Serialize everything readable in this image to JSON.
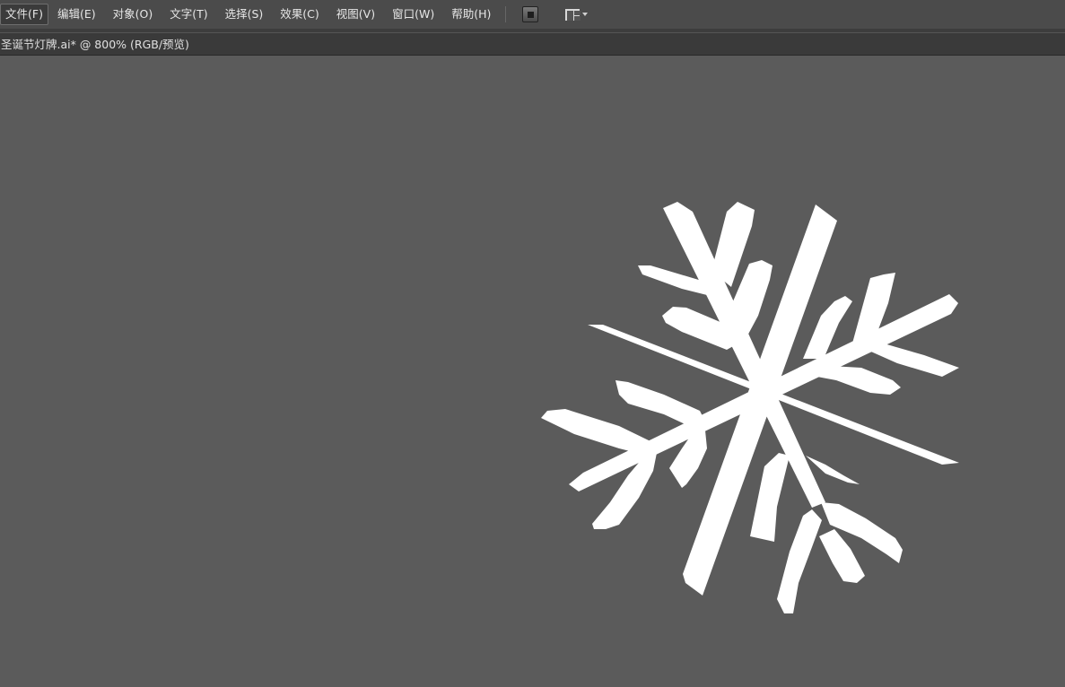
{
  "menubar": {
    "items": [
      {
        "label": "文件(F)"
      },
      {
        "label": "编辑(E)"
      },
      {
        "label": "对象(O)"
      },
      {
        "label": "文字(T)"
      },
      {
        "label": "选择(S)"
      },
      {
        "label": "效果(C)"
      },
      {
        "label": "视图(V)"
      },
      {
        "label": "窗口(W)"
      },
      {
        "label": "帮助(H)"
      }
    ],
    "bridge_icon": "bridge-icon",
    "arrange_icon": "arrange-documents-icon"
  },
  "document": {
    "tab_title": "圣诞节灯牌.ai* @ 800% (RGB/预览)"
  },
  "colors": {
    "canvas": "#5b5b5b",
    "menubar": "#4b4b4b",
    "artwork": "#ffffff"
  }
}
